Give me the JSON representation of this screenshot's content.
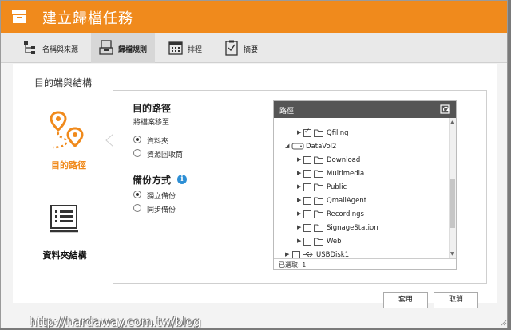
{
  "window": {
    "title": "建立歸檔任務"
  },
  "tabs": [
    {
      "label": "名稱與來源",
      "icon": "tree-structure-icon"
    },
    {
      "label": "歸檔規則",
      "icon": "archive-rule-icon"
    },
    {
      "label": "排程",
      "icon": "calendar-icon"
    },
    {
      "label": "摘要",
      "icon": "summary-clipboard-icon"
    }
  ],
  "section": {
    "title": "目的端與結構"
  },
  "leftnav": {
    "destination": "目的路徑",
    "folder_structure": "資料夾結構"
  },
  "destination": {
    "heading": "目的路徑",
    "subtext": "將檔案移至",
    "options": [
      "資料夾",
      "資源回收筒"
    ],
    "selected": 0
  },
  "backup": {
    "heading": "備份方式",
    "options": [
      "獨立備份",
      "同步備份"
    ],
    "selected": 0
  },
  "tree": {
    "header": "路徑",
    "nodes": [
      {
        "label": "Qfiling",
        "checked": true
      },
      {
        "label": "DataVol2",
        "checked": false
      },
      {
        "label": "Download",
        "checked": false
      },
      {
        "label": "Multimedia",
        "checked": false
      },
      {
        "label": "Public",
        "checked": false
      },
      {
        "label": "QmailAgent",
        "checked": false
      },
      {
        "label": "Recordings",
        "checked": false
      },
      {
        "label": "SignageStation",
        "checked": false
      },
      {
        "label": "Web",
        "checked": false
      },
      {
        "label": "USBDisk1",
        "checked": false
      }
    ],
    "footer": "已選取: 1"
  },
  "buttons": {
    "apply": "套用",
    "cancel": "取消"
  },
  "watermark": "http://hardaway.com.tw/blog",
  "colors": {
    "accent": "#f08a1c",
    "tree_header": "#555555",
    "info": "#2d8fd5"
  }
}
